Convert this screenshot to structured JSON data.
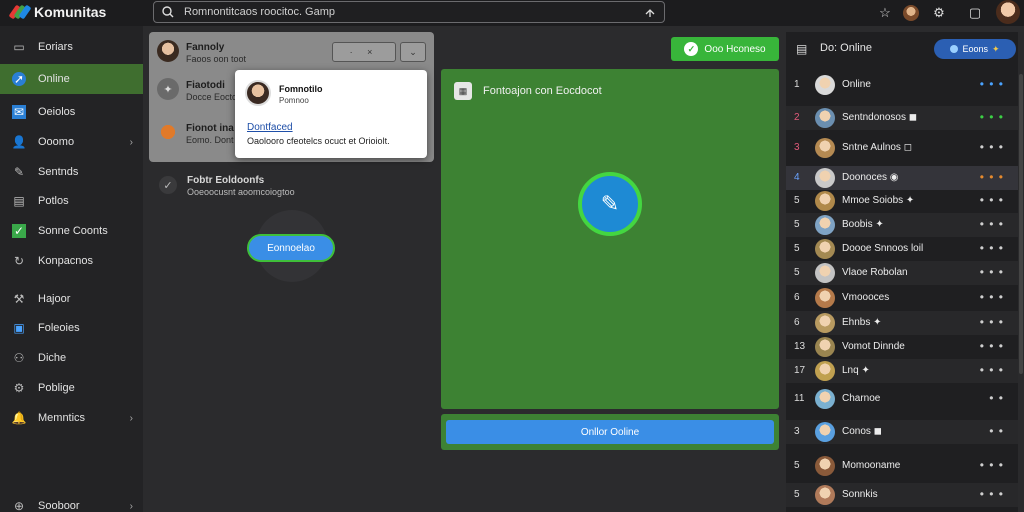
{
  "app": {
    "name": "Komunitas"
  },
  "search": {
    "placeholder": "Romnontitcaos roocitoc. Gamp"
  },
  "header_icons": [
    "star-icon",
    "avatar-icon",
    "settings-icon",
    "chat-icon",
    "profile-avatar"
  ],
  "sidebar": {
    "items": [
      {
        "label": "Eoriars",
        "icon": "display-icon",
        "active": false,
        "chevron": false
      },
      {
        "label": "Online",
        "icon": "compass-icon",
        "active": true,
        "chevron": false
      },
      {
        "label": "Oeiolos",
        "icon": "mail-icon",
        "active": false,
        "chevron": false
      },
      {
        "label": "Ooomo",
        "icon": "people-icon",
        "active": false,
        "chevron": true
      },
      {
        "label": "Sentnds",
        "icon": "pen-icon",
        "active": false,
        "chevron": false
      },
      {
        "label": "Potlos",
        "icon": "doc-icon",
        "active": false,
        "chevron": false
      },
      {
        "label": "Sonne Coonts",
        "icon": "checkbox-icon",
        "active": false,
        "chevron": false
      },
      {
        "label": "Konpacnos",
        "icon": "refresh-icon",
        "active": false,
        "chevron": false
      },
      {
        "label": "Hajoor",
        "icon": "tools-icon",
        "active": false,
        "chevron": false
      },
      {
        "label": "Foleoies",
        "icon": "image-icon",
        "active": false,
        "chevron": false
      },
      {
        "label": "Diche",
        "icon": "group-icon",
        "active": false,
        "chevron": false
      },
      {
        "label": "Poblige",
        "icon": "gear-icon",
        "active": false,
        "chevron": false
      },
      {
        "label": "Memntics",
        "icon": "bell-icon",
        "active": false,
        "chevron": true
      },
      {
        "label": "Sooboor",
        "icon": "help-icon",
        "active": false,
        "chevron": true
      }
    ]
  },
  "notifications": [
    {
      "title": "Fannoly",
      "subtitle": "Faoos oon toot"
    },
    {
      "title": "Fiaotodi",
      "subtitle": "Docce Eoctc"
    },
    {
      "title": "Fionot ina",
      "subtitle": "Eomo. Dont"
    }
  ],
  "popup": {
    "name": "Fomnotilo",
    "subtitle": "Pomnoo",
    "link": "Dontfaced",
    "text": "Oaolooro cfeotelcs ocuct et Orioiolt."
  },
  "check_item": {
    "title": "Fobtr Eoldoonfs",
    "subtitle": "Ooeoocusnt aoomcoiogtoo"
  },
  "pill_button": "Eonnoelao",
  "top_button": "Ooo Hconeso",
  "main_card": {
    "title": "Fontoajon con Eocdocot"
  },
  "bottom_button": "Onllor Ooline",
  "right_panel": {
    "title": "Do: Online",
    "badge": "Eoons",
    "users": [
      {
        "rank": "1",
        "name": "Online",
        "dots": "• • •",
        "dot_color": "#4aa3ff"
      },
      {
        "rank": "2",
        "name": "Sentndonosos ◼",
        "dots": "• • •",
        "dot_color": "#3ccf45"
      },
      {
        "rank": "3",
        "name": "Sntne Aulnos ◻",
        "dots": "• • •",
        "dot_color": "#cfcfcf"
      },
      {
        "rank": "4",
        "name": "Doonoces ◉",
        "dots": "• • •",
        "dot_color": "#e58a2e"
      },
      {
        "rank": "5",
        "name": "Mmoe Soiobs ✦",
        "dots": "• • •",
        "dot_color": "#cfcfcf"
      },
      {
        "rank": "5",
        "name": "Boobis ✦",
        "dots": "• • •",
        "dot_color": "#cfcfcf"
      },
      {
        "rank": "5",
        "name": "Doooe Snnoos loil",
        "dots": "• • •",
        "dot_color": "#cfcfcf"
      },
      {
        "rank": "5",
        "name": "Vlaoe Robolan",
        "dots": "• • •",
        "dot_color": "#cfcfcf"
      },
      {
        "rank": "6",
        "name": "Vmoooces",
        "dots": "• • •",
        "dot_color": "#cfcfcf"
      },
      {
        "rank": "6",
        "name": "Ehnbs ✦",
        "dots": "• • •",
        "dot_color": "#cfcfcf"
      },
      {
        "rank": "13",
        "name": "Vomot Dinnde",
        "dots": "• • •",
        "dot_color": "#cfcfcf"
      },
      {
        "rank": "17",
        "name": "Lnq ✦",
        "dots": "• • •",
        "dot_color": "#cfcfcf"
      },
      {
        "rank": "11",
        "name": "Charnoe",
        "dots": "• •",
        "dot_color": "#cfcfcf"
      },
      {
        "rank": "3",
        "name": "Conos ◼",
        "dots": "• •",
        "dot_color": "#cfcfcf"
      },
      {
        "rank": "5",
        "name": "Momooname",
        "dots": "• • •",
        "dot_color": "#cfcfcf"
      },
      {
        "rank": "5",
        "name": "Sonnkis",
        "dots": "• • •",
        "dot_color": "#cfcfcf"
      }
    ]
  },
  "colors": {
    "accent_green": "#3d8233",
    "accent_blue": "#3a8ee6",
    "bright_green": "#38b53a"
  }
}
